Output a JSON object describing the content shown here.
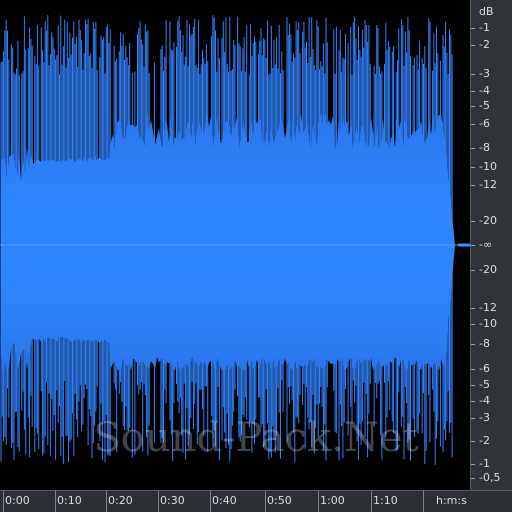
{
  "db_ruler": {
    "unit": "dB",
    "upper_labels": [
      "-1",
      "-2",
      "-3",
      "-4",
      "-5",
      "-6",
      "-8",
      "-10",
      "-12",
      "-20"
    ],
    "center_label": "-∞",
    "lower_labels": [
      "-20",
      "-12",
      "-10",
      "-8",
      "-6",
      "-5",
      "-4",
      "-3",
      "-2",
      "-1",
      "-0,5"
    ]
  },
  "time_ruler": {
    "labels": [
      "0:00",
      "0:10",
      "0:20",
      "0:30",
      "0:40",
      "0:50",
      "1:00",
      "1:10"
    ],
    "unit": "h:m:s"
  },
  "watermark": "Sound-Pack.Net",
  "colors": {
    "waveform": "#2f82fb",
    "background": "#000000",
    "ruler_bg": "#303438",
    "ruler_text": "#d7dee6"
  }
}
